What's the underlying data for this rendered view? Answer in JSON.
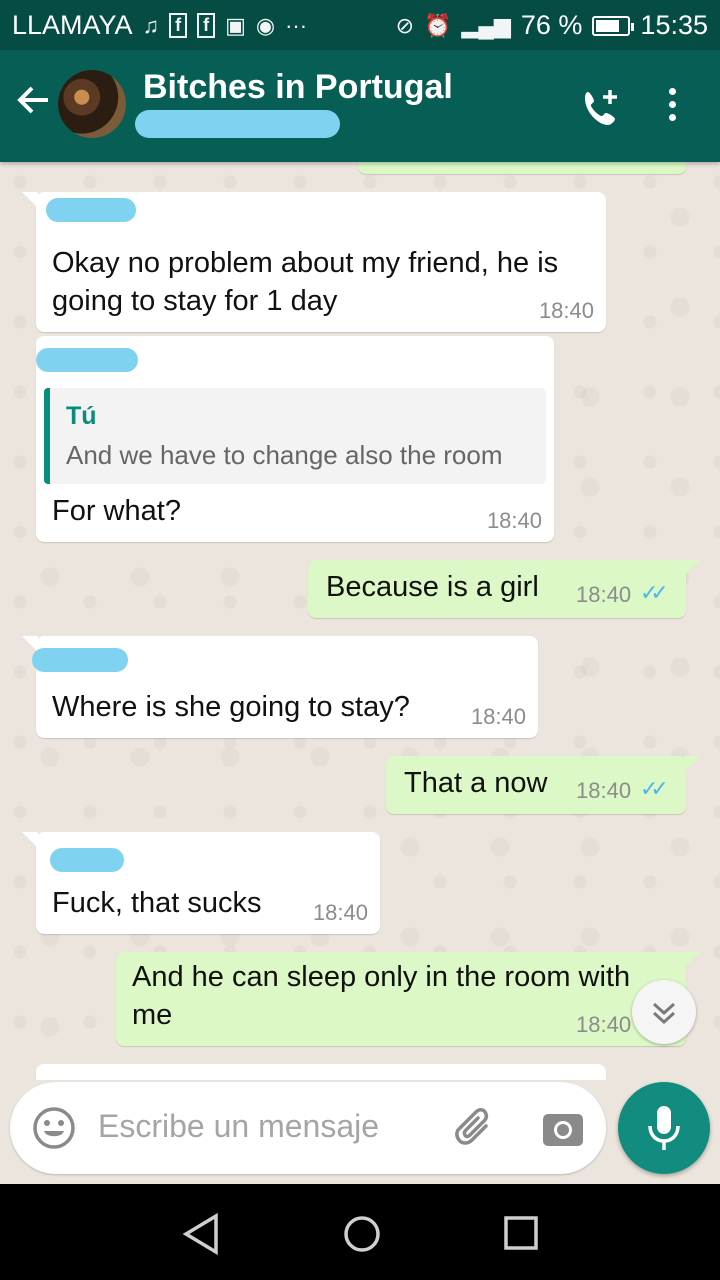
{
  "status_bar": {
    "carrier": "LLAMAYA",
    "battery": "76 %",
    "battery_level": 0.76,
    "time": "15:35",
    "more": "···"
  },
  "header": {
    "title": "Bitches in Portugal"
  },
  "messages": [
    {
      "direction": "in",
      "text": "Okay no problem about my friend, he is going to stay for 1 day",
      "time": "18:40"
    },
    {
      "direction": "in",
      "quote_author": "Tú",
      "quote_text": "And we have to change also the room",
      "text": "For what?",
      "time": "18:40"
    },
    {
      "direction": "out",
      "text": "Because is a girl",
      "time": "18:40",
      "read": true
    },
    {
      "direction": "in",
      "text": "Where is she going to stay?",
      "time": "18:40"
    },
    {
      "direction": "out",
      "text": "That a now",
      "time": "18:40",
      "read": true
    },
    {
      "direction": "in",
      "text": "Fuck, that sucks",
      "time": "18:40"
    },
    {
      "direction": "out",
      "text": "And he can sleep only in the room with me",
      "time": "18:40",
      "read": true
    }
  ],
  "composer": {
    "placeholder": "Escribe un mensaje"
  },
  "colors": {
    "header": "#075e54",
    "status_bar": "#054d44",
    "outgoing_bubble": "#dcf8c6",
    "incoming_bubble": "#ffffff",
    "accent": "#128c7e",
    "read_ticks": "#4fb6ec"
  },
  "icons": [
    "back-arrow-icon",
    "add-call-icon",
    "more-vert-icon",
    "emoji-icon",
    "attach-icon",
    "camera-icon",
    "mic-icon",
    "scroll-down-icon",
    "nav-back-icon",
    "nav-home-icon",
    "nav-recents-icon"
  ]
}
